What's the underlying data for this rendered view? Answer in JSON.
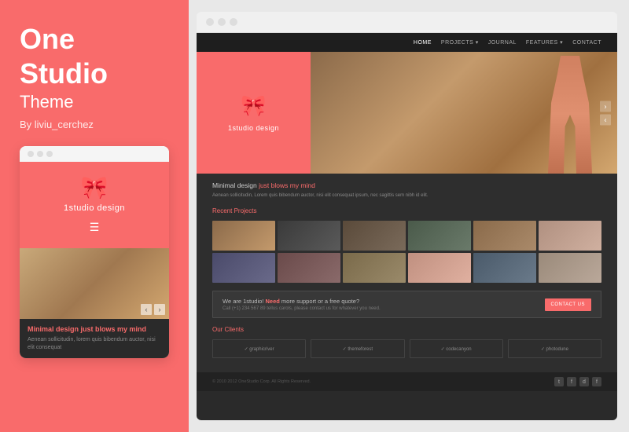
{
  "left": {
    "title_line1": "One",
    "title_line2": "Studio",
    "subtitle": "Theme",
    "author": "By liviu_cerchez"
  },
  "mobile": {
    "logo_text": "1studio design",
    "headline": "Minimal design just blows my mind",
    "body_text": "Aenean sollicitudin, lorem quis bibendum auctor, nisi elit consequat"
  },
  "desktop": {
    "nav_items": [
      "HOME",
      "PROJECTS ▾",
      "JOURNAL",
      "FEATURES ▾",
      "CONTACT"
    ],
    "hero_logo_text": "1studio design",
    "tagline_normal": "Minimal design ",
    "tagline_highlight": "just blows my mind",
    "description": "Aenean sollicitudin, Lorem quis bibendum auctor, nisi elit consequat ipsum, nec sagittis sem nibh id elit.",
    "recent_projects": "Recent Projects",
    "cta_text1": "We are 1studio! ",
    "cta_text2": "Need",
    "cta_text3": " more support or a free quote?",
    "cta_sub": "Call (+1) 234 567 89 tellus carols, please contact us for whatever you need.",
    "cta_btn": "CONTACT US",
    "clients_title": "Our Clients",
    "clients": [
      "✓ graphicriver",
      "✓ themeforest",
      "✓ codecanyon",
      "✓ photodune"
    ],
    "footer_copy": "© 2010 2012 OneStudio Corp. All Rights Reserved.",
    "social_icons": [
      "t",
      "f",
      "d",
      "f"
    ]
  },
  "colors": {
    "accent": "#f96b6b",
    "dark_bg": "#2a2a2a",
    "left_bg": "#f96b6b"
  }
}
